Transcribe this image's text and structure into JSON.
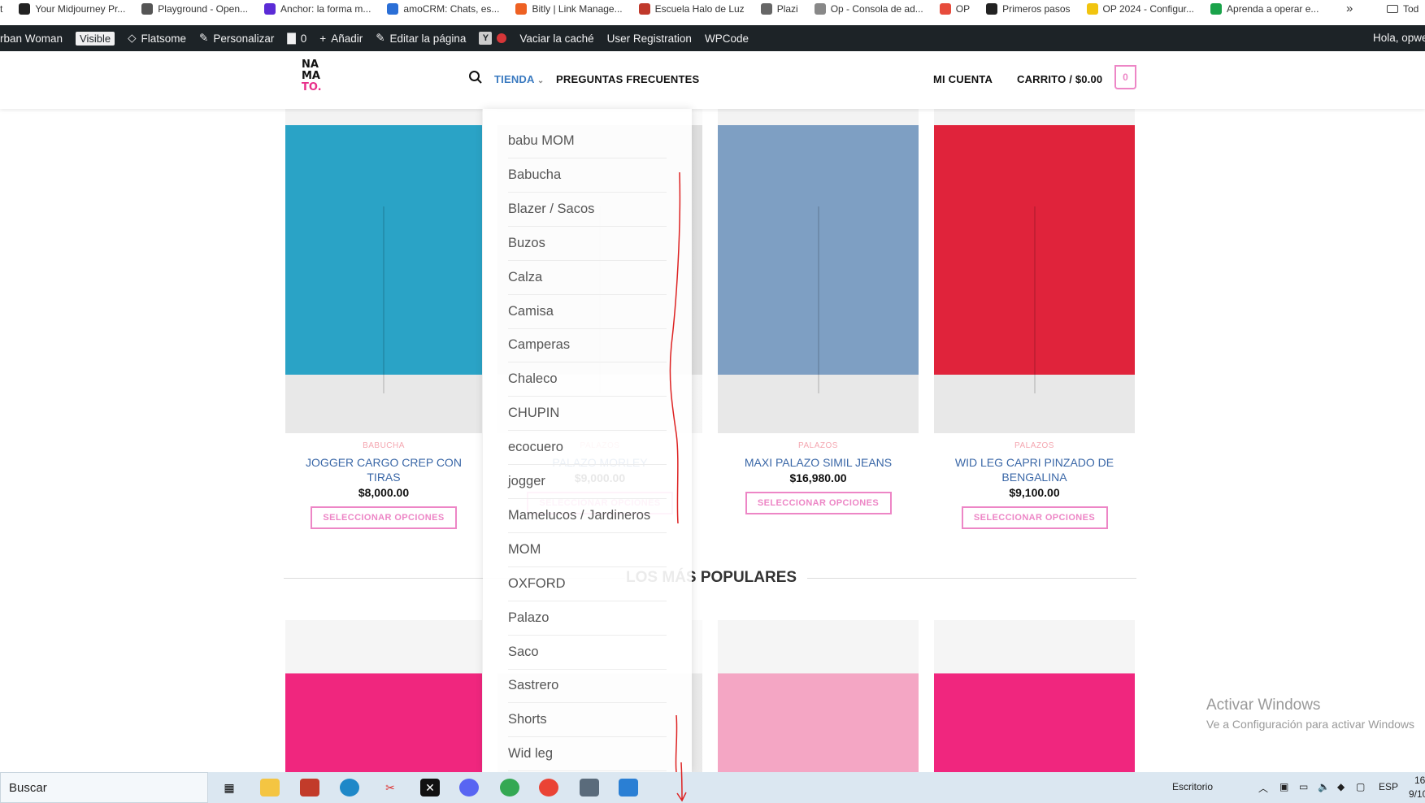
{
  "bookmarks": [
    {
      "label": "t",
      "color": "#444"
    },
    {
      "label": "Your Midjourney Pr...",
      "color": "#222"
    },
    {
      "label": "Playground - Open...",
      "color": "#555"
    },
    {
      "label": "Anchor: la forma m...",
      "color": "#5b2bd6"
    },
    {
      "label": "amoCRM: Chats, es...",
      "color": "#2b6fd6"
    },
    {
      "label": "Bitly | Link Manage...",
      "color": "#ee6123"
    },
    {
      "label": "Escuela Halo de Luz",
      "color": "#c0392b"
    },
    {
      "label": "Plazi",
      "color": "#666"
    },
    {
      "label": "Op - Consola de ad...",
      "color": "#888"
    },
    {
      "label": "OP",
      "color": "#e74c3c"
    },
    {
      "label": "Primeros pasos",
      "color": "#222"
    },
    {
      "label": "OP 2024 - Configur...",
      "color": "#f1c40f"
    },
    {
      "label": "Aprenda a operar e...",
      "color": "#1aa34a"
    }
  ],
  "bookmarks_more": "»",
  "bookmarks_folder": "Tod",
  "adminbar": {
    "site": "rban Woman",
    "visible_badge": "Visible",
    "flatsome": "Flatsome",
    "personalizar": "Personalizar",
    "comments_count": "0",
    "add": "Añadir",
    "edit_page": "Editar la página",
    "clear_cache": "Vaciar la caché",
    "user_registration": "User Registration",
    "wpcode": "WPCode",
    "greeting": "Hola, opwe"
  },
  "header": {
    "logo_lines": [
      "NA",
      "MA",
      "TO."
    ],
    "nav_tienda": "TIENDA",
    "nav_faq": "PREGUNTAS FRECUENTES",
    "nav_account": "MI CUENTA",
    "nav_cart": "CARRITO / $0.00",
    "cart_count": "0"
  },
  "products": [
    {
      "category": "BABUCHA",
      "title_lines": [
        "JOGGER CARGO CREP CON",
        "TIRAS"
      ],
      "price": "$8,000.00",
      "button": "SELECCIONAR OPCIONES",
      "color": "#2aa3c6"
    },
    {
      "category": "PALAZOS",
      "title_lines": [
        "PALAZO MORLEY"
      ],
      "price": "$9,000.00",
      "button": "SELECCIONAR OPCIONES",
      "color": "#b8b8b8"
    },
    {
      "category": "PALAZOS",
      "title_lines": [
        "MAXI PALAZO SIMIL JEANS"
      ],
      "price": "$16,980.00",
      "button": "SELECCIONAR OPCIONES",
      "color": "#7e9fc3"
    },
    {
      "category": "PALAZOS",
      "title_lines": [
        "WID LEG CAPRI PINZADO DE",
        "BENGALINA"
      ],
      "price": "$9,100.00",
      "button": "SELECCIONAR OPCIONES",
      "color": "#e0233b"
    }
  ],
  "section_title": "LOS MÁS POPULARES",
  "popular_colors": [
    "#f0267e",
    "#cfcfcf",
    "#f4a6c4",
    "#f0267e"
  ],
  "dropdown": [
    "babu MOM",
    "Babucha",
    "Blazer / Sacos",
    "Buzos",
    "Calza",
    "Camisa",
    "Camperas",
    "Chaleco",
    "CHUPIN",
    "ecocuero",
    "jogger",
    "Mamelucos / Jardineros",
    "MOM",
    "OXFORD",
    "Palazo",
    "Saco",
    "Sastrero",
    "Shorts",
    "Wid leg"
  ],
  "watermark": {
    "title": "Activar Windows",
    "subtitle": "Ve a Configuración para activar Windows"
  },
  "taskbar": {
    "search": "Buscar",
    "desktop": "Escritorio",
    "lang": "ESP",
    "time": "16",
    "date": "9/10"
  }
}
